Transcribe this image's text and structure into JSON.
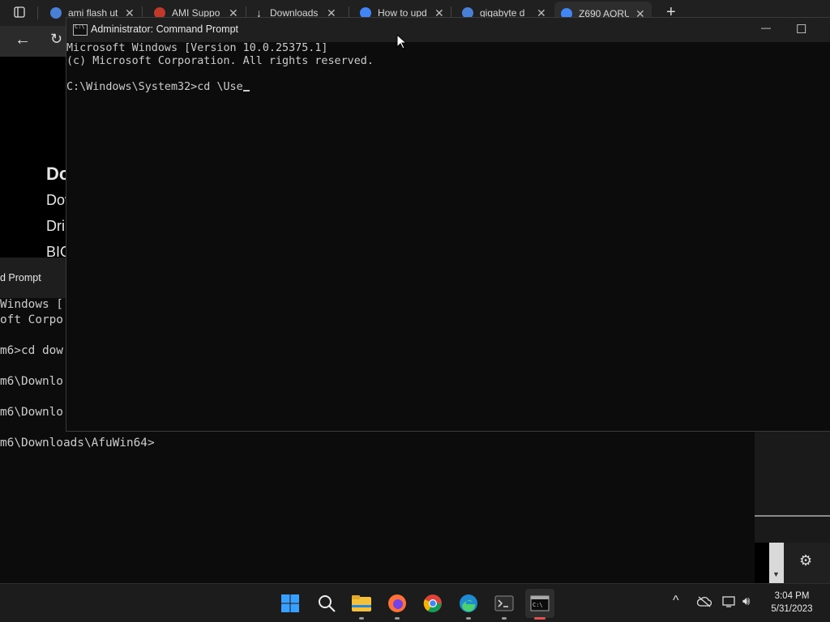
{
  "browser": {
    "tabs": [
      {
        "title": "ami flash ut",
        "favicon_color": "#4a7fd6",
        "close": "✕"
      },
      {
        "title": "AMI Suppo",
        "favicon_color": "#c0392b",
        "close": "✕"
      },
      {
        "title": "Downloads",
        "favicon_color": "",
        "close": "✕"
      },
      {
        "title": "How to upd",
        "favicon_color": "#4285f4",
        "close": "✕"
      },
      {
        "title": "gigabyte d",
        "favicon_color": "#4a7fd6",
        "close": "✕"
      },
      {
        "title": "Z690 AORU",
        "favicon_color": "#4285f4",
        "close": "✕"
      }
    ],
    "new_tab": "+",
    "page_lines": [
      "Do",
      "Dov",
      "Dri",
      "BIO"
    ]
  },
  "background_cmd": {
    "title_fragment": "d Prompt",
    "lines": [
      "Windows [",
      "oft Corpo",
      "",
      "m6>cd dow",
      "",
      "m6\\Downlo",
      "",
      "m6\\Downlo",
      "",
      "m6\\Downloads\\AfuWin64>"
    ]
  },
  "cmd": {
    "title": "Administrator: Command Prompt",
    "minimize": "—",
    "maximize": "☐",
    "lines": [
      "Microsoft Windows [Version 10.0.25375.1]",
      "(c) Microsoft Corporation. All rights reserved.",
      "",
      "C:\\Windows\\System32>cd \\Use"
    ]
  },
  "taskbar": {
    "time": "3:04 PM",
    "date": "5/31/2023",
    "icons": [
      "start-icon",
      "search-icon",
      "file-explorer-icon",
      "firefox-icon",
      "chrome-icon",
      "edge-icon",
      "terminal-icon",
      "command-prompt-icon"
    ],
    "tray": [
      "chevron-up-icon",
      "cloud-off-icon",
      "network-icon",
      "volume-icon"
    ]
  },
  "colors": {
    "accent": "#0078d4",
    "terminal_bg": "#0c0c0c",
    "terminal_fg": "#cccccc"
  }
}
